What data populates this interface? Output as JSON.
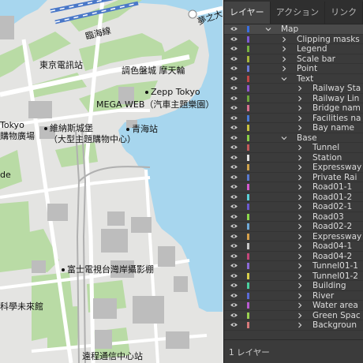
{
  "map": {
    "labels": [
      {
        "id": "railway-label",
        "text": "臨海線",
        "dot": false,
        "rot": true
      },
      {
        "id": "tokyo-teleport",
        "text": "東京電訊站",
        "dot": false
      },
      {
        "id": "palette-town",
        "text": "調色盤城 摩天輪",
        "dot": false
      },
      {
        "id": "zepp",
        "text": "Zepp Tokyo",
        "dot": true
      },
      {
        "id": "megaweb",
        "text": "MEGA WEB（汽車主題樂園）",
        "dot": false
      },
      {
        "id": "venus-fort-1",
        "text": "維納斯城堡",
        "dot": true
      },
      {
        "id": "venus-fort-2",
        "text": "（大型主題購物中心）",
        "dot": false
      },
      {
        "id": "aomi-station",
        "text": "青海站",
        "dot": true
      },
      {
        "id": "tokyo-1",
        "text": "Tokyo",
        "dot": false
      },
      {
        "id": "tokyo-2",
        "text": "購物廣場",
        "dot": false
      },
      {
        "id": "de",
        "text": "de",
        "dot": false
      },
      {
        "id": "fuji-tv",
        "text": "富士電視台灣岸攝影棚",
        "dot": true
      },
      {
        "id": "miraikan",
        "text": "科學未來館",
        "dot": false
      },
      {
        "id": "telecom-center",
        "text": "遠程通信中心站",
        "dot": false
      },
      {
        "id": "yumenoohashi",
        "text": "夢之大",
        "dot": false
      }
    ]
  },
  "panel": {
    "tabs": [
      "レイヤー",
      "アクション",
      "リンク"
    ],
    "active_tab": "レイヤー",
    "layers": [
      {
        "name": "Map",
        "color": "#3b6fe0",
        "indent": 0,
        "expanded": true,
        "selected": true
      },
      {
        "name": "Clipping masks",
        "color": "#7c5bd6",
        "indent": 1,
        "expanded": false
      },
      {
        "name": "Legend",
        "color": "#79b240",
        "indent": 1,
        "expanded": false
      },
      {
        "name": "Scale bar",
        "color": "#a8b83a",
        "indent": 1,
        "expanded": false
      },
      {
        "name": "Point",
        "color": "#6b7ad8",
        "indent": 1,
        "expanded": false
      },
      {
        "name": "Text",
        "color": "#c24646",
        "indent": 1,
        "expanded": true
      },
      {
        "name": "Railway Sta",
        "color": "#8f55cf",
        "indent": 2,
        "expanded": false
      },
      {
        "name": "Railway Lin",
        "color": "#6fa63b",
        "indent": 2,
        "expanded": false
      },
      {
        "name": "Bridge nam",
        "color": "#d9708f",
        "indent": 2,
        "expanded": false
      },
      {
        "name": "Facilities na",
        "color": "#4a7bd8",
        "indent": 2,
        "expanded": false
      },
      {
        "name": "Bay name",
        "color": "#c9c23e",
        "indent": 2,
        "expanded": false
      },
      {
        "name": "Base",
        "color": "#8ad047",
        "indent": 1,
        "expanded": true
      },
      {
        "name": "Tunnel",
        "color": "#c45a5a",
        "indent": 2,
        "expanded": false
      },
      {
        "name": "Station",
        "color": "#e0e0e0",
        "indent": 2,
        "expanded": false
      },
      {
        "name": "Expressway",
        "color": "#cfa24a",
        "indent": 2,
        "expanded": false
      },
      {
        "name": "Private Rai",
        "color": "#5a7ad0",
        "indent": 2,
        "expanded": false
      },
      {
        "name": "Road01-1",
        "color": "#d45ad0",
        "indent": 2,
        "expanded": false
      },
      {
        "name": "Road01-2",
        "color": "#5ad0d8",
        "indent": 2,
        "expanded": false
      },
      {
        "name": "Road02-1",
        "color": "#6a5ad0",
        "indent": 2,
        "expanded": false
      },
      {
        "name": "Road03",
        "color": "#8cd84a",
        "indent": 2,
        "expanded": false
      },
      {
        "name": "Road02-2",
        "color": "#6fa9d8",
        "indent": 2,
        "expanded": false
      },
      {
        "name": "Expressway",
        "color": "#d8a04a",
        "indent": 2,
        "expanded": false
      },
      {
        "name": "Road04-1",
        "color": "#c8c8c8",
        "indent": 2,
        "expanded": false
      },
      {
        "name": "Road04-2",
        "color": "#c4467a",
        "indent": 2,
        "expanded": false
      },
      {
        "name": "Tunnel01-1",
        "color": "#8a6ad8",
        "indent": 2,
        "expanded": false
      },
      {
        "name": "Tunnel01-2",
        "color": "#d8cf4a",
        "indent": 2,
        "expanded": false
      },
      {
        "name": "Building",
        "color": "#4ad0a0",
        "indent": 2,
        "expanded": false
      },
      {
        "name": "River",
        "color": "#5a6ad8",
        "indent": 2,
        "expanded": false
      },
      {
        "name": "Water area",
        "color": "#b85ad0",
        "indent": 2,
        "expanded": false
      },
      {
        "name": "Green Spac",
        "color": "#9ad050",
        "indent": 2,
        "expanded": false
      },
      {
        "name": "Backgroun",
        "color": "#d87a7a",
        "indent": 2,
        "expanded": false
      }
    ],
    "footer": "1 レイヤー"
  }
}
